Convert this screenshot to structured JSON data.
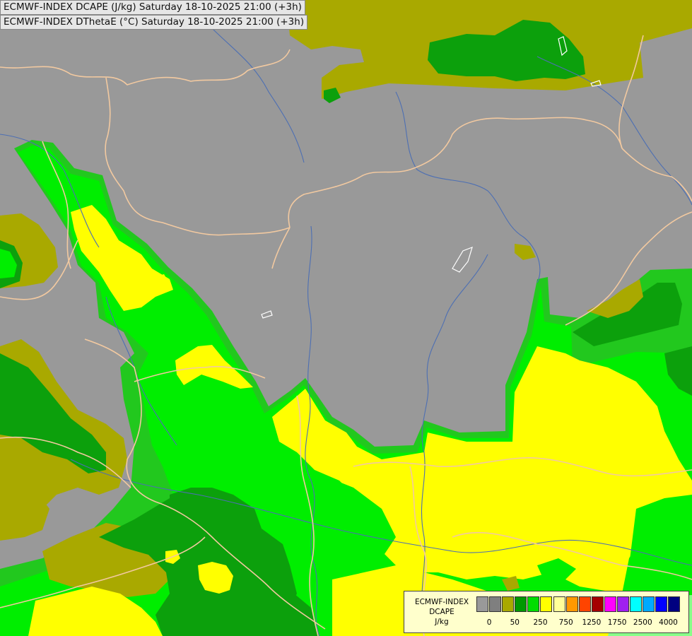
{
  "header": {
    "line1": "ECMWF-INDEX DCAPE (J/kg) Saturday 18-10-2025 21:00 (+3h)",
    "line2": "ECMWF-INDEX DThetaE (°C) Saturday 18-10-2025 21:00 (+3h)"
  },
  "legend": {
    "title_line1": "ECMWF-INDEX",
    "title_line2": "DCAPE",
    "title_line3": "J/kg",
    "colors": [
      "#999999",
      "#7f7f7f",
      "#a9a900",
      "#009900",
      "#00dd00",
      "#ffff00",
      "#ffff99",
      "#ff9900",
      "#ff4400",
      "#a50000",
      "#ff00ff",
      "#a020f0",
      "#00ffff",
      "#00aaff",
      "#0000ff",
      "#000080"
    ],
    "ticks": [
      "0",
      "50",
      "250",
      "750",
      "1250",
      "1750",
      "2500",
      "4000"
    ]
  },
  "map_colors": {
    "background": "#999999",
    "olive": "#a9a900",
    "dark_green": "#0ca00c",
    "mid_green": "#22c81e",
    "bright_green": "#00ee00",
    "yellow": "#ffff00",
    "light_yellow": "#ffff88",
    "borders": "#f2c9a0",
    "rivers": "#4d6fb3"
  }
}
